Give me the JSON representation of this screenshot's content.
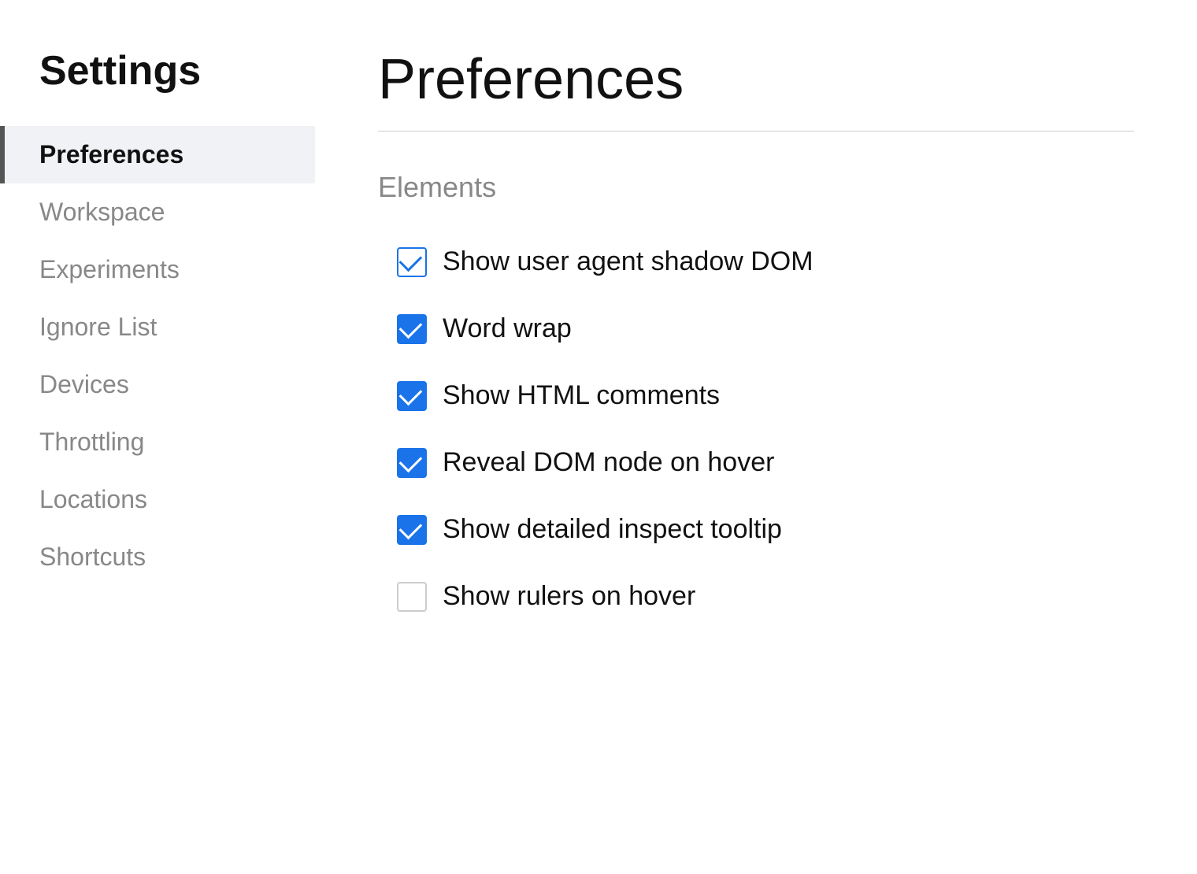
{
  "sidebar": {
    "title": "Settings",
    "items": [
      {
        "id": "preferences",
        "label": "Preferences",
        "active": true
      },
      {
        "id": "workspace",
        "label": "Workspace",
        "active": false
      },
      {
        "id": "experiments",
        "label": "Experiments",
        "active": false
      },
      {
        "id": "ignore-list",
        "label": "Ignore List",
        "active": false
      },
      {
        "id": "devices",
        "label": "Devices",
        "active": false
      },
      {
        "id": "throttling",
        "label": "Throttling",
        "active": false
      },
      {
        "id": "locations",
        "label": "Locations",
        "active": false
      },
      {
        "id": "shortcuts",
        "label": "Shortcuts",
        "active": false
      }
    ]
  },
  "main": {
    "page_title": "Preferences",
    "sections": [
      {
        "id": "elements",
        "title": "Elements",
        "checkboxes": [
          {
            "id": "shadow-dom",
            "label": "Show user agent shadow DOM",
            "checked": true,
            "outlined": true
          },
          {
            "id": "word-wrap",
            "label": "Word wrap",
            "checked": true,
            "outlined": false
          },
          {
            "id": "html-comments",
            "label": "Show HTML comments",
            "checked": true,
            "outlined": false
          },
          {
            "id": "reveal-dom",
            "label": "Reveal DOM node on hover",
            "checked": true,
            "outlined": false
          },
          {
            "id": "inspect-tooltip",
            "label": "Show detailed inspect tooltip",
            "checked": true,
            "outlined": false
          },
          {
            "id": "rulers-hover",
            "label": "Show rulers on hover",
            "checked": false,
            "outlined": false
          }
        ]
      }
    ]
  }
}
